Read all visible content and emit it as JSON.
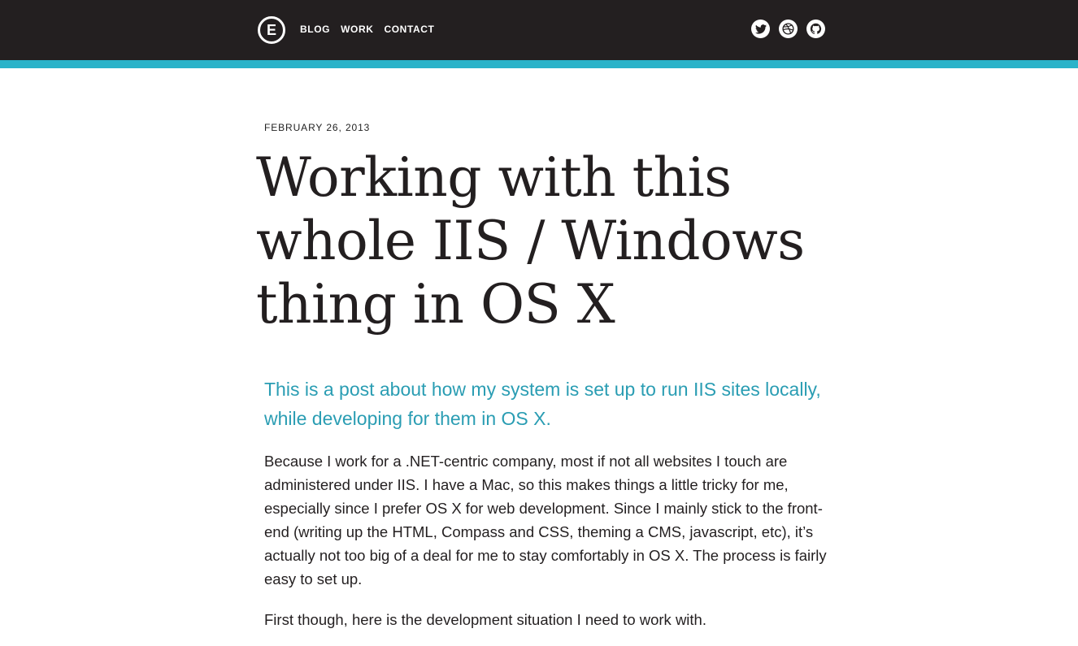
{
  "header": {
    "logo_letter": "E",
    "nav": [
      {
        "label": "BLOG"
      },
      {
        "label": "WORK"
      },
      {
        "label": "CONTACT"
      }
    ],
    "social": [
      {
        "icon": "twitter-icon"
      },
      {
        "icon": "dribbble-icon"
      },
      {
        "icon": "github-icon"
      }
    ]
  },
  "colors": {
    "topbar": "#231f20",
    "accent": "#2bb3c9",
    "lede": "#2a9db3"
  },
  "post": {
    "date": "FEBRUARY 26, 2013",
    "title": "Working with this whole IIS / Windows thing in OS X",
    "lede": "This is a post about how my system is set up to run IIS sites locally, while developing for them in OS X.",
    "paragraphs": [
      "Because I work for a .NET-centric company, most if not all websites I touch are administered under IIS. I have a Mac, so this makes things a little tricky for me, especially since I prefer OS X for web development. Since I mainly stick to the front-end (writing up the HTML, Compass and CSS, theming a CMS, javascript, etc), it’s actually not too big of a deal for me to stay comfortably in OS X. The process is fairly easy to set up.",
      "First though, here is the development situation I need to work with."
    ]
  }
}
